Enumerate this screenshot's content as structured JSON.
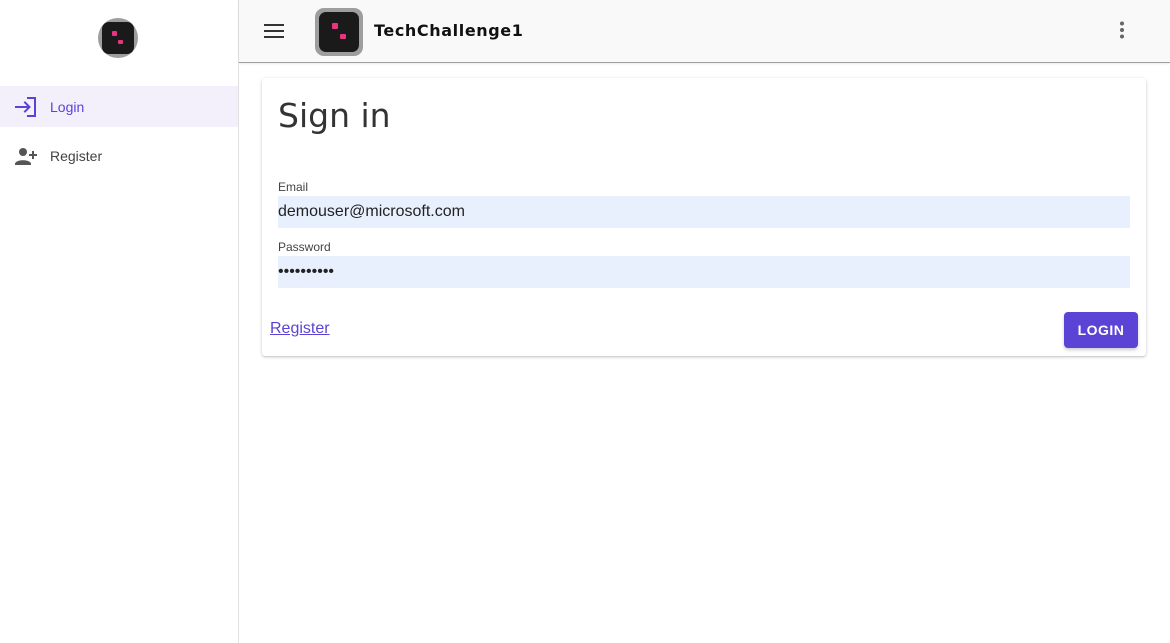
{
  "app": {
    "title": "TechChallenge1"
  },
  "sidebar": {
    "items": [
      {
        "label": "Login",
        "icon": "login-icon",
        "active": true
      },
      {
        "label": "Register",
        "icon": "person-add-icon",
        "active": false
      }
    ]
  },
  "signin": {
    "title": "Sign in",
    "email_label": "Email",
    "email_value": "demouser@microsoft.com",
    "password_label": "Password",
    "password_value": "••••••••••",
    "register_link": "Register",
    "login_button": "LOGIN"
  },
  "colors": {
    "accent": "#5b43d6",
    "input_bg": "#e8f0fe",
    "logo_pink": "#e6357e"
  }
}
